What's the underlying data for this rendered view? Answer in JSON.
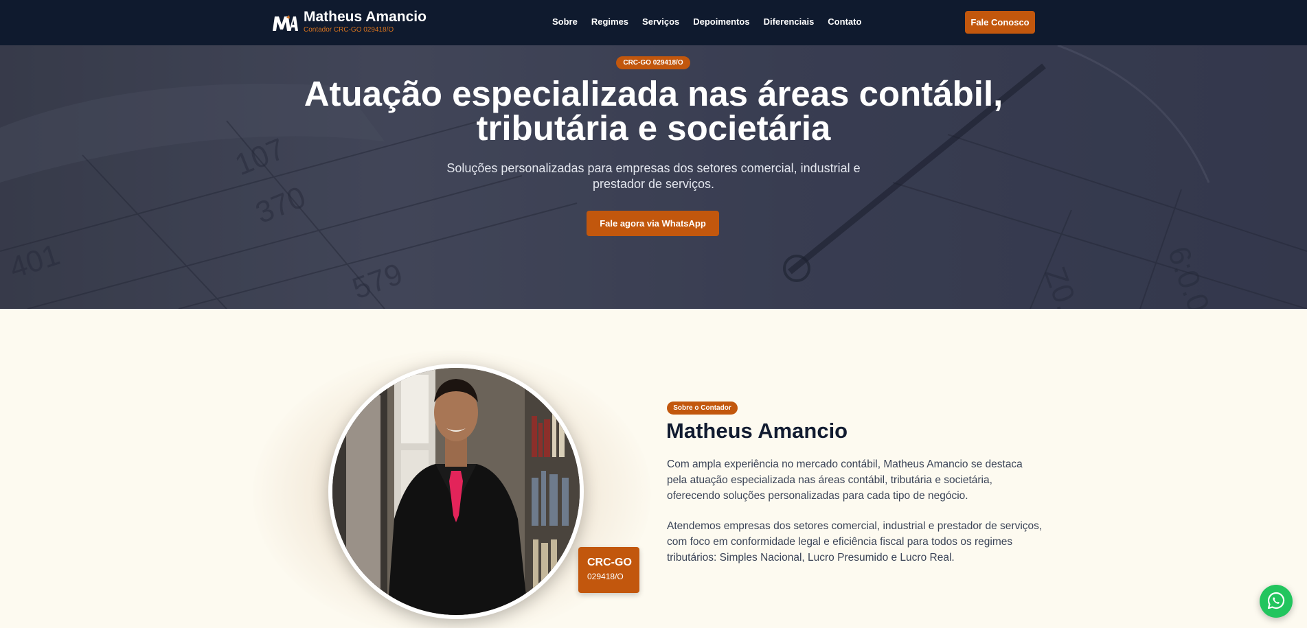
{
  "header": {
    "logo_text": "MA",
    "brand_name": "Matheus Amancio",
    "brand_subtitle": "Contador CRC-GO 029418/O",
    "nav": [
      "Sobre",
      "Regimes",
      "Serviços",
      "Depoimentos",
      "Diferenciais",
      "Contato"
    ],
    "cta_label": "Fale Conosco"
  },
  "hero": {
    "badge": "CRC-GO 029418/O",
    "title": "Atuação especializada nas áreas contábil, tributária e societária",
    "subtitle": "Soluções personalizadas para empresas dos setores comercial, industrial e prestador de serviços.",
    "cta_label": "Fale agora via WhatsApp"
  },
  "about": {
    "badge": "Sobre o Contador",
    "title": "Matheus Amancio",
    "paragraph_1": "Com ampla experiência no mercado contábil, Matheus Amancio se destaca pela atuação especializada nas áreas contábil, tributária e societária, oferecendo soluções personalizadas para cada tipo de negócio.",
    "paragraph_2": "Atendemos empresas dos setores comercial, industrial e prestador de serviços, com foco em conformidade legal e eficiência fiscal para todos os regimes tributários: Simples Nacional, Lucro Presumido e Lucro Real.",
    "crc_line1": "CRC-GO",
    "crc_line2": "029418/O"
  },
  "colors": {
    "header_bg": "#0f1a2e",
    "accent": "#c2570d",
    "page_bg": "#fdfaf0",
    "whatsapp": "#22c55e"
  },
  "icons": {
    "floating_button": "whatsapp-icon"
  }
}
